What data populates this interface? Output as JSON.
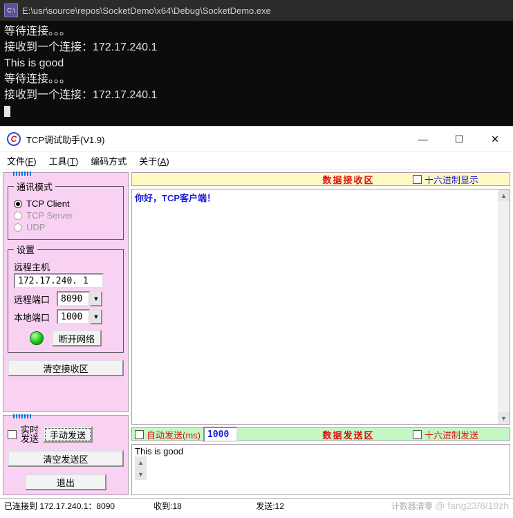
{
  "console": {
    "icon_label": "C:\\",
    "title": "E:\\usr\\source\\repos\\SocketDemo\\x64\\Debug\\SocketDemo.exe",
    "lines": [
      "等待连接。。。",
      "接收到一个连接：172.17.240.1",
      "This is good",
      "等待连接。。。",
      "接收到一个连接：172.17.240.1"
    ]
  },
  "app": {
    "title": "TCP调试助手(V1.9)",
    "win": {
      "min": "—",
      "max": "☐",
      "close": "✕"
    },
    "menu": {
      "file": "文件(F)",
      "tools": "工具(T)",
      "encoding": "编码方式",
      "about": "关于(A)"
    }
  },
  "left": {
    "mode": {
      "legend": "通讯模式",
      "tcp_client": "TCP Client",
      "tcp_server": "TCP Server",
      "udp": "UDP"
    },
    "settings": {
      "legend": "设置",
      "remote_host_label": "远程主机",
      "remote_host_value": "172.17.240. 1",
      "remote_port_label": "远程端口",
      "remote_port_value": "8090",
      "local_port_label": "本地端口",
      "local_port_value": "1000",
      "disconnect_btn": "断开网络"
    },
    "clear_recv_btn": "清空接收区",
    "realtime_label": "实时\n发送",
    "manual_send_btn": "手动发送",
    "clear_send_btn": "清空发送区",
    "exit_btn": "退出"
  },
  "right": {
    "recv_header": "数据接收区",
    "recv_hex_label": "十六进制显示",
    "recv_text": "你好，TCP客户端！",
    "auto_send_label": "自动发送(ms)",
    "auto_send_value": "1000",
    "send_header": "数据发送区",
    "send_hex_label": "十六进制发送",
    "send_text": "This is good"
  },
  "status": {
    "conn": "已连接到 172.17.240.1：8090",
    "recv": "收到:18",
    "send": "发送:12",
    "counter_reset": "计数器清零",
    "watermark": "@ fang23/8/19zh"
  }
}
